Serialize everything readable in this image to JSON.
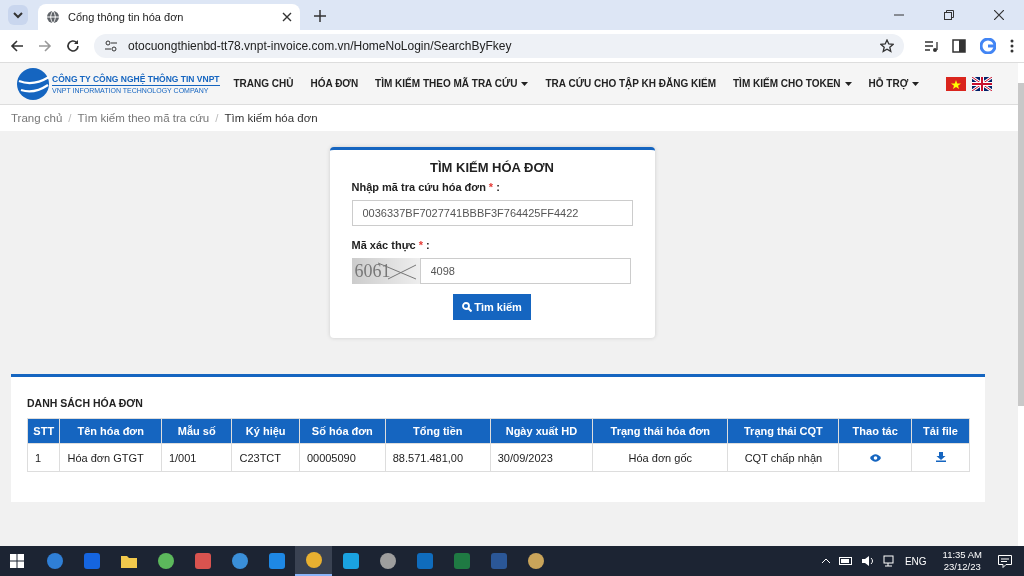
{
  "browser": {
    "tab_title": "Cổng thông tin hóa đơn",
    "url": "otocuongthienbd-tt78.vnpt-invoice.com.vn/HomeNoLogin/SearchByFkey"
  },
  "header": {
    "logo_title": "CÔNG TY CÔNG NGHỆ THÔNG TIN VNPT",
    "logo_subtitle": "VNPT INFORMATION TECHNOLOGY COMPANY",
    "nav": [
      {
        "label": "TRANG CHỦ",
        "has_menu": false
      },
      {
        "label": "HÓA ĐƠN",
        "has_menu": false
      },
      {
        "label": "TÌM KIẾM THEO MÃ TRA CỨU",
        "has_menu": true
      },
      {
        "label": "TRA CỨU CHO TẬP KH ĐĂNG KIỂM",
        "has_menu": false
      },
      {
        "label": "TÌM KIẾM CHO TOKEN",
        "has_menu": true
      },
      {
        "label": "HỖ TRỢ",
        "has_menu": true
      }
    ]
  },
  "breadcrumb": [
    {
      "label": "Trang chủ"
    },
    {
      "separator": "/",
      "label": "Tìm kiếm theo mã tra cứu"
    },
    {
      "separator": "/",
      "label": "Tìm kiếm hóa đơn"
    }
  ],
  "search_form": {
    "title": "TÌM KIẾM HÓA ĐƠN",
    "code_label": "Nhập mã tra cứu hóa đơn",
    "code_required": "*",
    "code_colon": ":",
    "code_value": "0036337BF7027741BBBF3F764425FF4422",
    "captcha_label": "Mã xác thực",
    "captcha_required": "*",
    "captcha_colon": ":",
    "captcha_text": "6061",
    "captcha_value": "4098",
    "button": "Tìm kiếm"
  },
  "invoice_list": {
    "title": "DANH SÁCH HÓA ĐƠN",
    "columns": [
      "STT",
      "Tên hóa đơn",
      "Mẫu số",
      "Ký hiệu",
      "Số hóa đơn",
      "Tổng tiền",
      "Ngày xuất HD",
      "Trạng thái hóa đơn",
      "Trạng thái CQT",
      "Thao tác",
      "Tải file"
    ],
    "rows": [
      {
        "cells": [
          "1",
          "Hóa đơn GTGT",
          "1/001",
          "C23TCT",
          "00005090",
          "88.571.481,00",
          "30/09/2023",
          "Hóa đơn gốc",
          "CQT chấp nhận"
        ]
      }
    ]
  },
  "taskbar": {
    "apps": [
      {
        "kind": "circle",
        "color": "#2f7fd6",
        "active": false
      },
      {
        "kind": "square",
        "color": "#1565e0",
        "active": false
      },
      {
        "kind": "folder",
        "color": "#f2c94c",
        "active": false
      },
      {
        "kind": "circle",
        "color": "#5cb85c",
        "active": false
      },
      {
        "kind": "square",
        "color": "#d9534f",
        "active": false
      },
      {
        "kind": "circle",
        "color": "#3a8fd9",
        "active": false
      },
      {
        "kind": "square",
        "color": "#1e88e5",
        "active": false
      },
      {
        "kind": "circle",
        "color": "#e8b030",
        "active": true
      },
      {
        "kind": "square",
        "color": "#1aa2e0",
        "active": false
      },
      {
        "kind": "circle",
        "color": "#9e9e9e",
        "active": false
      },
      {
        "kind": "square",
        "color": "#0f6cbd",
        "active": false
      },
      {
        "kind": "square",
        "color": "#1f7a43",
        "active": false
      },
      {
        "kind": "square",
        "color": "#2b5797",
        "active": false
      },
      {
        "kind": "circle",
        "color": "#c9a45a",
        "active": false
      }
    ],
    "language": "ENG",
    "time": "11:35 AM",
    "date": "23/12/23"
  }
}
